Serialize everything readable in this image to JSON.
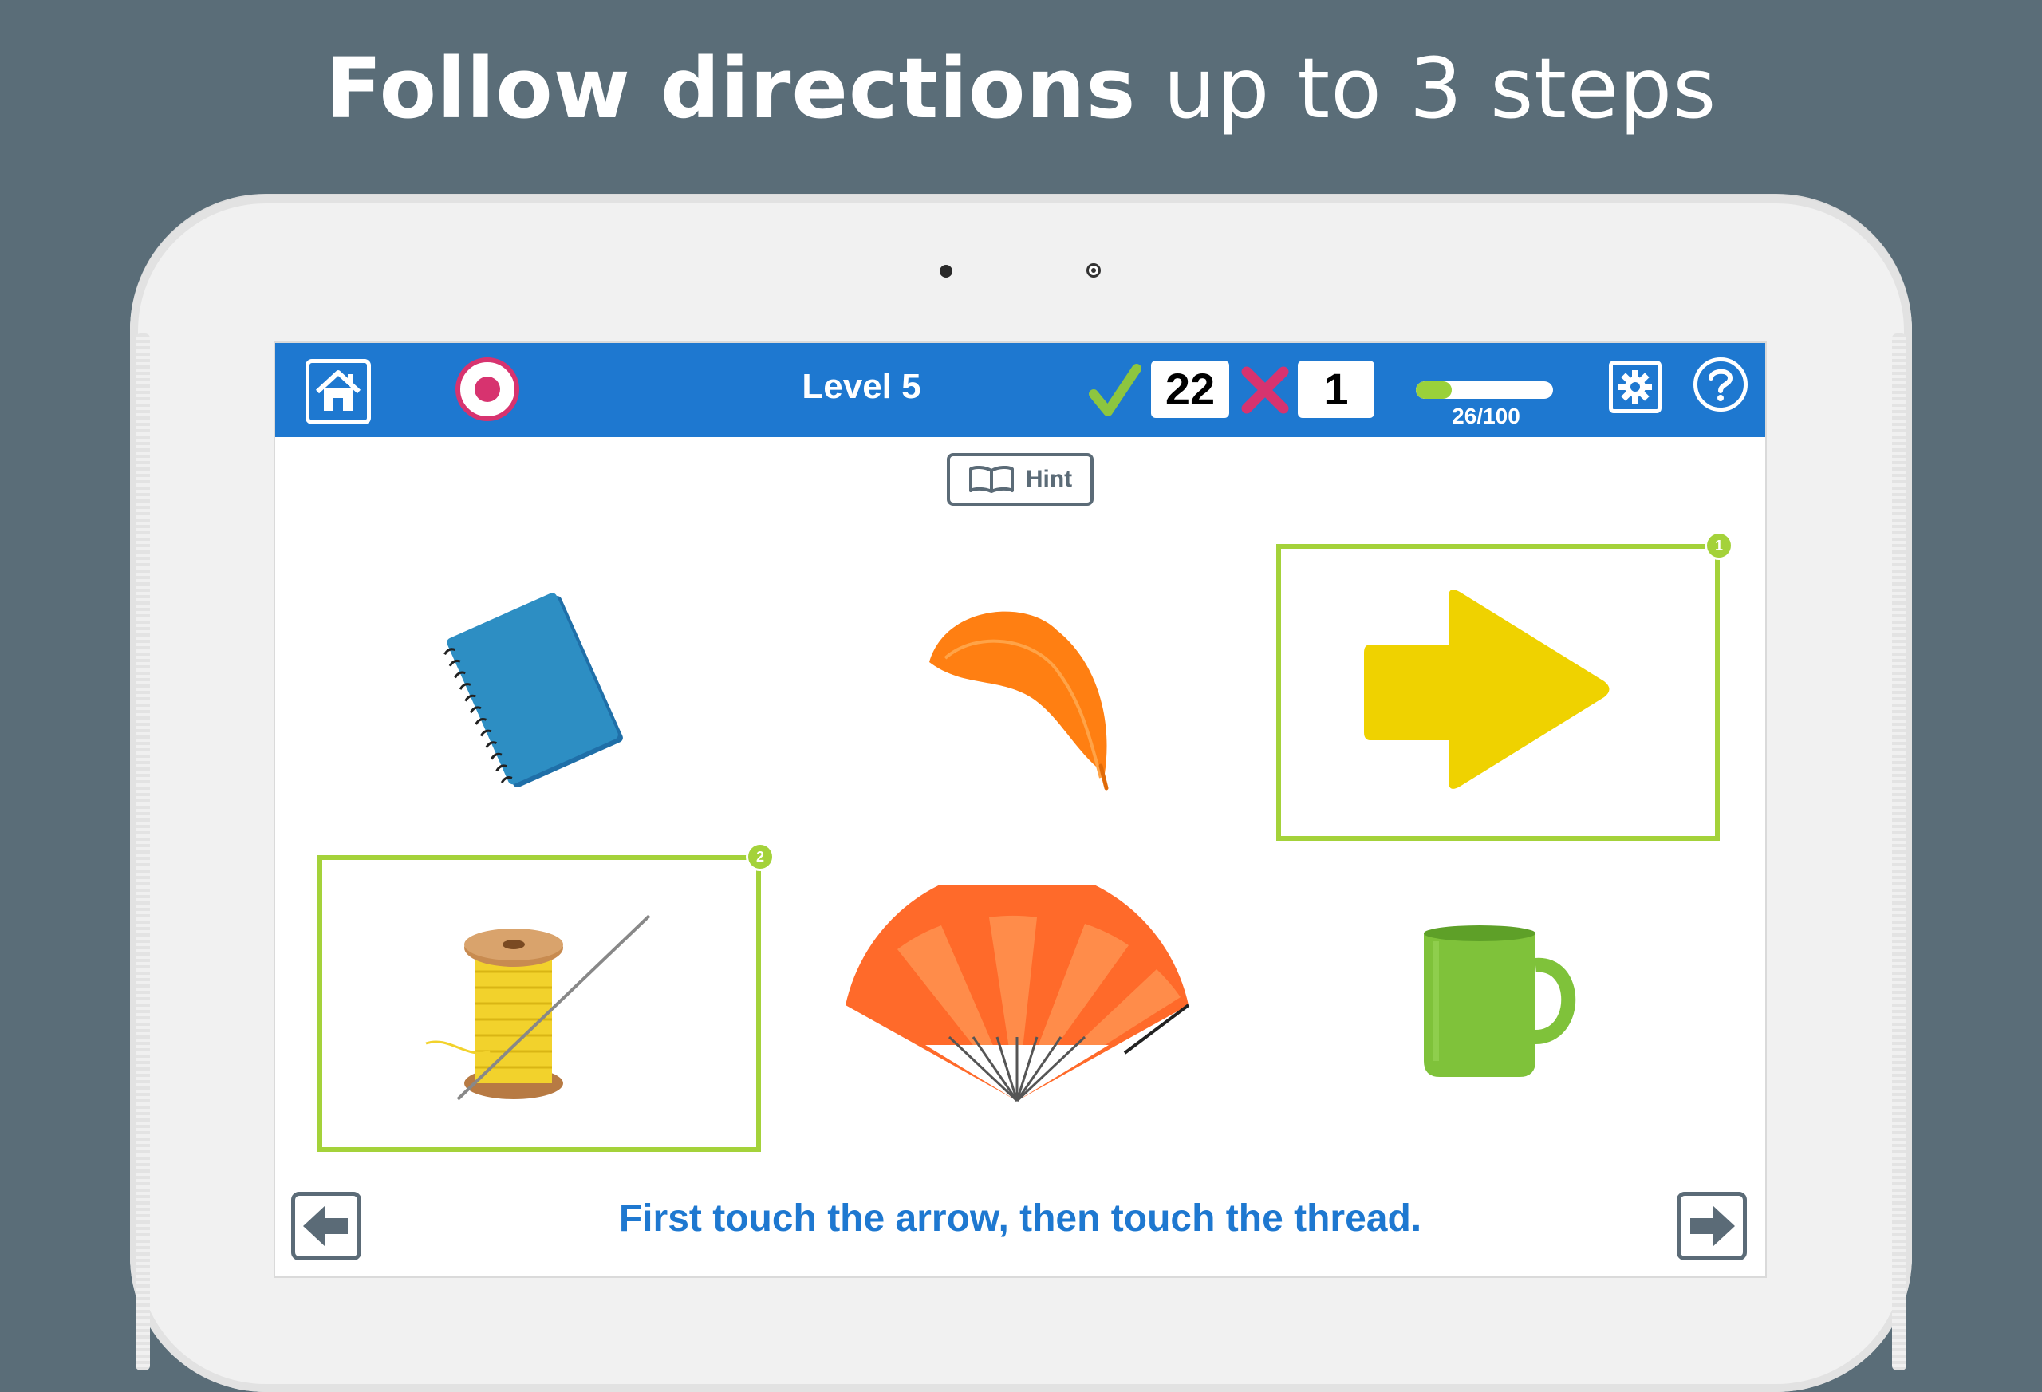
{
  "headline": {
    "bold": "Follow directions",
    "light": "up to 3 steps"
  },
  "colors": {
    "background": "#5a6d78",
    "topbar": "#1e78d0",
    "accent_green": "#a4d23a",
    "instruction_blue": "#1e78d0",
    "record": "#d7336f"
  },
  "topbar": {
    "home_icon": "home-icon",
    "record_icon": "record-icon",
    "level_label": "Level 5",
    "correct_icon": "checkmark-icon",
    "correct_count": "22",
    "wrong_icon": "x-mark-icon",
    "wrong_count": "1",
    "progress": {
      "value": 26,
      "max": 100,
      "text": "26/100"
    },
    "settings_icon": "gear-icon",
    "help_icon": "question-icon"
  },
  "hint": {
    "label": "Hint",
    "icon": "book-icon"
  },
  "cards": [
    {
      "item": "notebook",
      "selected": false,
      "order": ""
    },
    {
      "item": "feather",
      "selected": false,
      "order": ""
    },
    {
      "item": "arrow",
      "selected": true,
      "order": "1"
    },
    {
      "item": "thread",
      "selected": true,
      "order": "2"
    },
    {
      "item": "fan",
      "selected": false,
      "order": ""
    },
    {
      "item": "mug",
      "selected": false,
      "order": ""
    }
  ],
  "instruction": "First touch the arrow, then touch the thread.",
  "nav": {
    "prev_icon": "arrow-left-icon",
    "next_icon": "arrow-right-icon"
  }
}
